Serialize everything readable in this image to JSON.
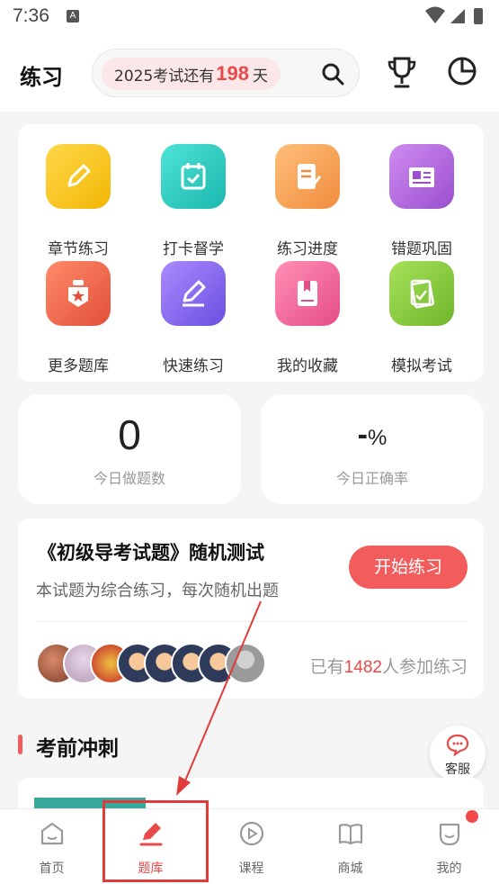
{
  "status_bar": {
    "time": "7:36",
    "notification_icon": "A"
  },
  "header": {
    "title": "练习",
    "countdown_prefix": "2025考试还有",
    "countdown_days": "198",
    "countdown_suffix": "天",
    "icons": [
      "search-icon",
      "trophy-icon",
      "pie-chart-icon"
    ]
  },
  "grid": {
    "items": [
      {
        "label": "章节练习",
        "icon": "pencil-icon",
        "color": "#f5c518"
      },
      {
        "label": "打卡督学",
        "icon": "calendar-check-icon",
        "color": "#2fcfc4"
      },
      {
        "label": "练习进度",
        "icon": "document-edit-icon",
        "color": "#f5a45b"
      },
      {
        "label": "错题巩固",
        "icon": "newspaper-icon",
        "color": "#b36ad8"
      },
      {
        "label": "更多题库",
        "icon": "badge-star-icon",
        "color": "#f0654a"
      },
      {
        "label": "快速练习",
        "icon": "quick-edit-icon",
        "color": "#8a6df0"
      },
      {
        "label": "我的收藏",
        "icon": "bookmark-book-icon",
        "color": "#f06a9a"
      },
      {
        "label": "模拟考试",
        "icon": "exam-paper-icon",
        "color": "#8acb3a"
      }
    ]
  },
  "stats": {
    "today_count_value": "0",
    "today_count_label": "今日做题数",
    "accuracy_value": "-",
    "accuracy_unit": "%",
    "accuracy_label": "今日正确率"
  },
  "practice": {
    "title": "《初级导考试题》随机测试",
    "subtitle": "本试题为综合练习，每次随机出题",
    "start_button": "开始练习",
    "joined_prefix": "已有",
    "joined_count": "1482",
    "joined_suffix": "人参加练习"
  },
  "section": {
    "title": "考前冲刺",
    "customer_service": "客服"
  },
  "tabs": [
    {
      "label": "首页",
      "icon": "home-icon"
    },
    {
      "label": "题库",
      "icon": "edit-pen-icon",
      "active": true
    },
    {
      "label": "课程",
      "icon": "play-circle-icon"
    },
    {
      "label": "商城",
      "icon": "book-open-icon"
    },
    {
      "label": "我的",
      "icon": "smile-icon"
    }
  ],
  "colors": {
    "accent": "#f25c5c",
    "highlight": "#e03a3a"
  }
}
